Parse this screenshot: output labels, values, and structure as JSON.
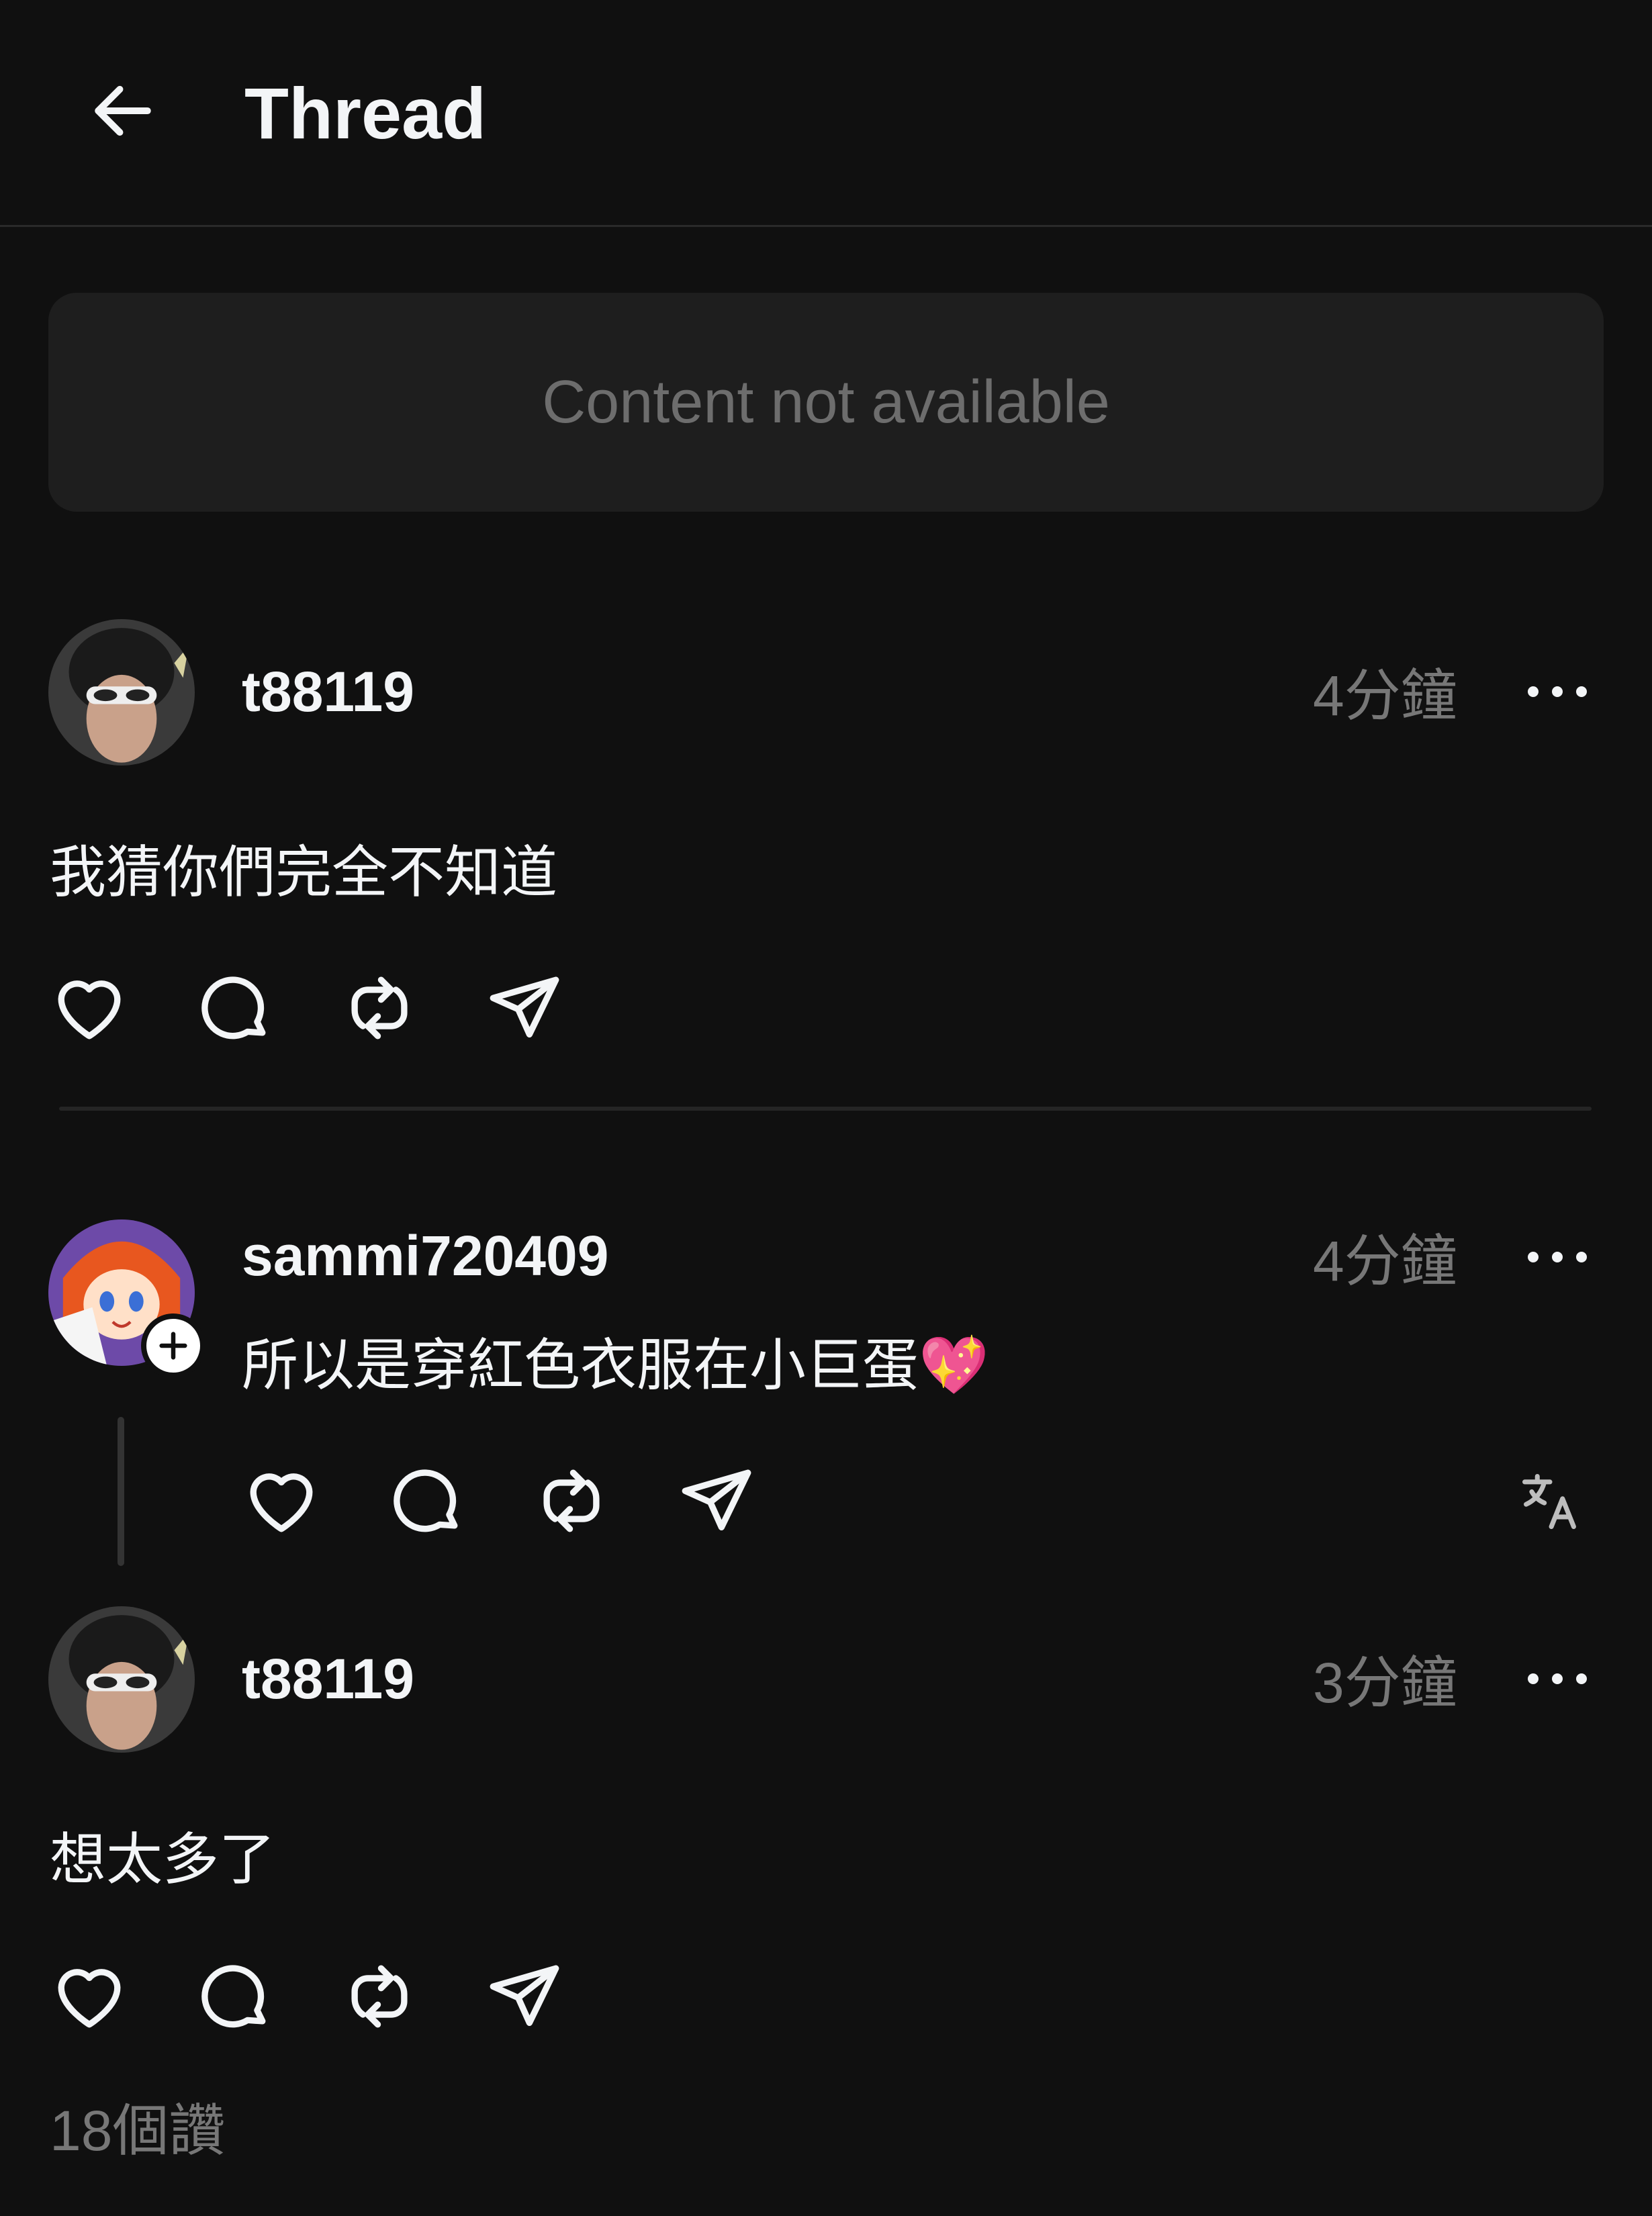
{
  "header": {
    "title": "Thread",
    "back_icon": "arrow-left-icon"
  },
  "unavailable": {
    "text": "Content not available"
  },
  "posts": [
    {
      "username": "t88119",
      "time": "4分鐘",
      "text": "我猜你們完全不知道"
    },
    {
      "username": "sammi720409",
      "time": "4分鐘",
      "text": "所以是穿紅色衣服在小巨蛋💖"
    },
    {
      "username": "t88119",
      "time": "3分鐘",
      "text": "想太多了",
      "likes": "18個讚"
    }
  ],
  "icons": [
    "heart-icon",
    "comment-icon",
    "repost-icon",
    "send-icon",
    "more-icon",
    "translate-icon",
    "plus-icon"
  ],
  "colors": {
    "background": "#101010",
    "text": "#f3f5f7",
    "muted": "#777777",
    "card": "#1e1e1e"
  }
}
